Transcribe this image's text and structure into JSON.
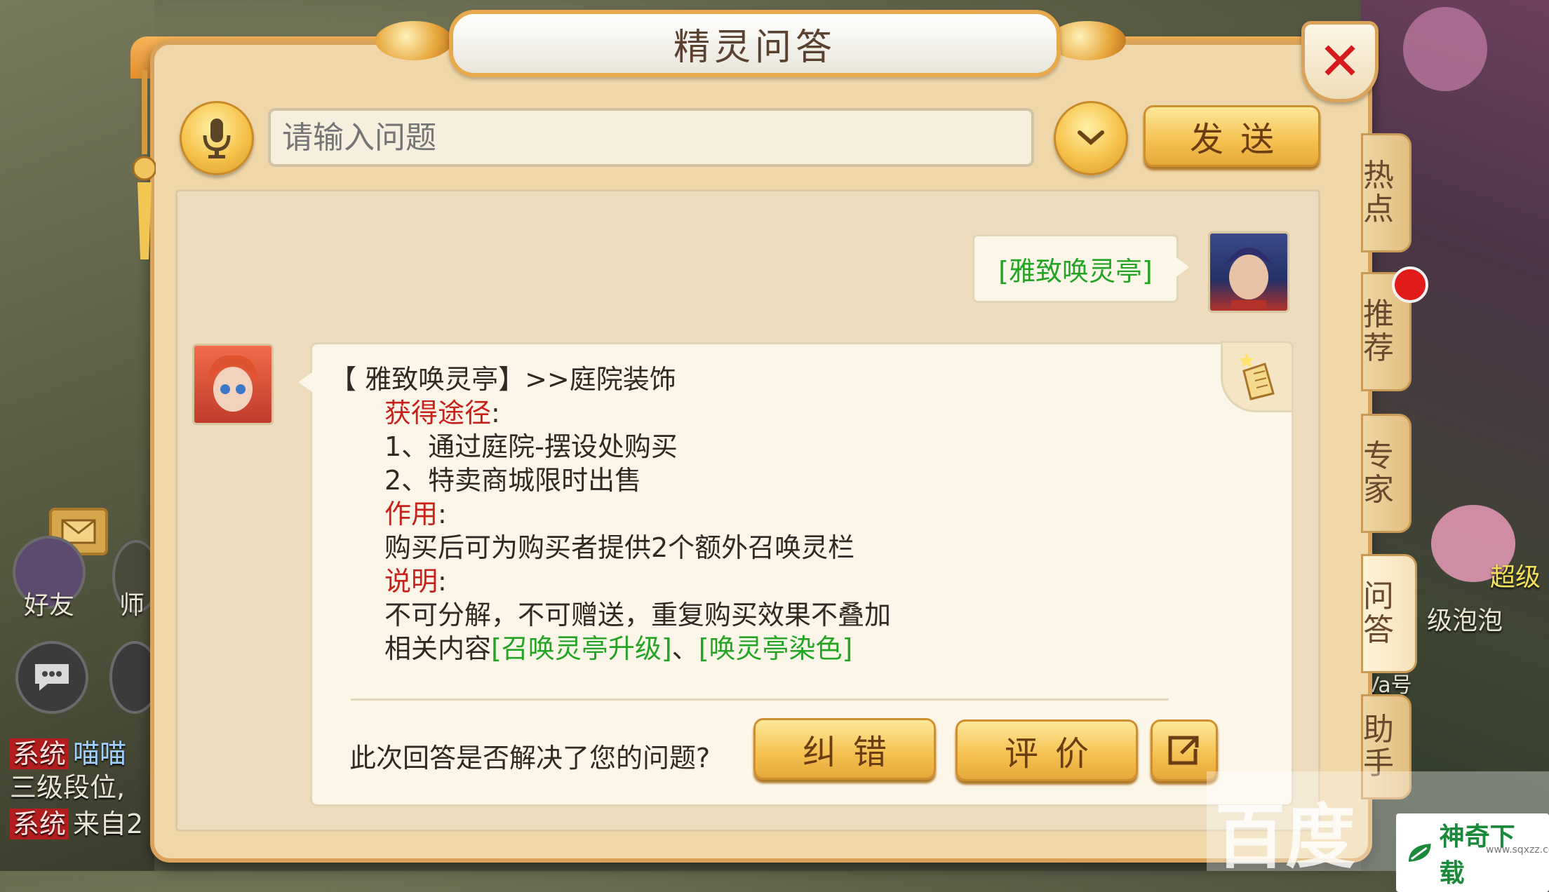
{
  "dialog": {
    "title": "精灵问答",
    "close_label": "✕"
  },
  "input": {
    "placeholder": "请输入问题",
    "value": ""
  },
  "send_button": "发送",
  "user_message": "[雅致唤灵亭]",
  "answer": {
    "header": "【 雅致唤灵亭】>>庭院装饰",
    "section1_title": "获得途径",
    "item1": "1、通过庭院-摆设处购买",
    "item2": "2、特卖商城限时出售",
    "section2_title": "作用",
    "effect": "购买后可为购买者提供2个额外召唤灵栏",
    "section3_title": "说明",
    "note": "不可分解，不可赠送，重复购买效果不叠加",
    "related_prefix": "相关内容",
    "related_link1": "[召唤灵亭升级]",
    "related_sep": "、",
    "related_link2": "[唤灵亭染色]",
    "colon": ":"
  },
  "feedback": {
    "question": "此次回答是否解决了您的问题?",
    "correct_button": "纠错",
    "rate_button": "评价"
  },
  "side_tabs": [
    {
      "label": "热点"
    },
    {
      "label": "推荐"
    },
    {
      "label": "专家"
    },
    {
      "label": "问答"
    },
    {
      "label": "助手"
    }
  ],
  "background": {
    "friends_label": "好友",
    "master_label": "师",
    "chat1_tag": "系统",
    "chat1_name": "喵喵",
    "chat2": "三级段位,",
    "chat3_tag": "系统",
    "chat3": "来自2",
    "right1": "超级",
    "right2": "级泡泡",
    "right3": "Va号"
  },
  "watermark": {
    "baidu": "百度",
    "brand": "神奇下载",
    "url": "www.sqxzz.com"
  },
  "colors": {
    "link_green": "#24a424",
    "label_red": "#c8211c",
    "close_red": "#d41a1a",
    "button_gold": "#f5c04f"
  }
}
